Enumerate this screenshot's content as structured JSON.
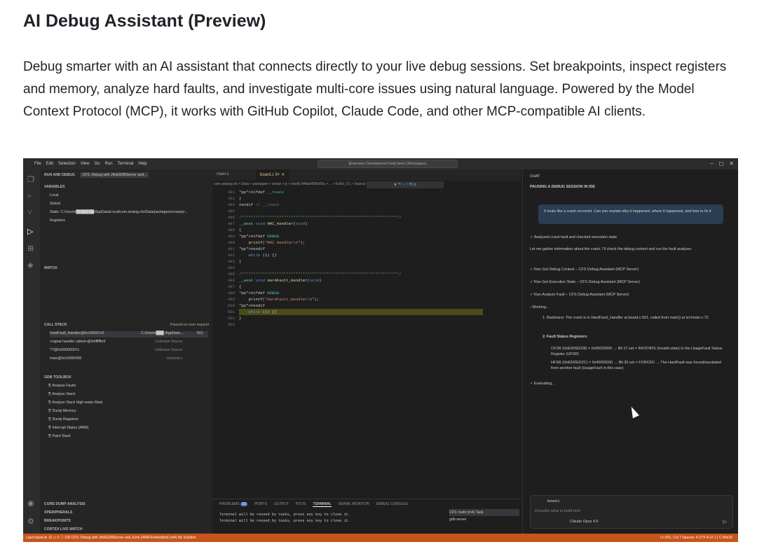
{
  "article": {
    "title": "AI Debug Assistant (Preview)",
    "body": "Debug smarter with an AI assistant that connects directly to your live debug sessions. Set breakpoints, inspect registers and memory, analyze hard faults, and investigate multi-core issues using natural language. Powered by the Model Context Protocol (MCP), it works with GitHub Copilot, Claude Code, and other MCP-compatible AI clients."
  },
  "window": {
    "menu": [
      "File",
      "Edit",
      "Selection",
      "View",
      "Go",
      "Run",
      "Terminal",
      "Help"
    ],
    "search": "[Extension Development Host] demo (Workspace)"
  },
  "sidebar": {
    "run_debug": "RUN AND DEBUG",
    "config": "CFS: Debug with JlinkGDBServer and...",
    "variables": "VARIABLES",
    "local": "Local",
    "global": "Global",
    "static": "Static: C:/Users/███████/AppData/Local/com.analog.cfs/Data/packages/conan/p/...",
    "registers": "Registers",
    "watch": "WATCH",
    "call_stack": "CALL STACK",
    "paused": "Paused on user request",
    "frames": [
      {
        "name": "HardFault_Handler@0x100007c0",
        "file": "C:/Users/███ /AppData...",
        "line": "501"
      },
      {
        "name": "<signal handler called>@0xfffffffe9",
        "file": "Unknown Source",
        "line": ""
      },
      {
        "name": "??@0x00000007c",
        "file": "Unknown Source",
        "line": ""
      },
      {
        "name": "main@0x10000458",
        "file": "src/main.c",
        "line": ""
      }
    ],
    "gdb_toolbox": "GDB TOOLBOX",
    "tools": [
      "Analyze Faults",
      "Analyze Stack",
      "Analyze Stack High-water Mark",
      "Dump Memory",
      "Dump Registers",
      "Interrupt Status (ARM)",
      "Paint Stack"
    ],
    "bottom_sections": [
      "CORE DUMP ANALYSIS",
      "XPERIPHERALS",
      "BREAKPOINTS",
      "CORTEX LIVE WATCH"
    ]
  },
  "editor": {
    "tabs": [
      "main.c",
      "board.c 9+"
    ],
    "breadcrumb": "com.analog.cfs > Data > packages > conan > p > msdk7d4ba5426e00a > ... > EvKit_V1 > Source > board.c",
    "lines": [
      {
        "n": "481",
        "t": "#ifdef __riscv"
      },
      {
        "n": "483",
        "t": "}"
      },
      {
        "n": "484",
        "t": "#endif // __riscv"
      },
      {
        "n": "485",
        "t": ""
      },
      {
        "n": "486",
        "t": "/*******************************************************************/"
      },
      {
        "n": "487",
        "t": "__weak void NMI_Handler(void)"
      },
      {
        "n": "488",
        "t": "{"
      },
      {
        "n": "489",
        "t": "#ifdef DEBUG"
      },
      {
        "n": "490",
        "t": "    printf(\"NMI Handler\\n\");"
      },
      {
        "n": "491",
        "t": "#endif"
      },
      {
        "n": "492",
        "t": "    while (1) {}"
      },
      {
        "n": "493",
        "t": "}"
      },
      {
        "n": "494",
        "t": ""
      },
      {
        "n": "495",
        "t": "/*******************************************************************/"
      },
      {
        "n": "496",
        "t": "__weak void HardFault_Handler(void)"
      },
      {
        "n": "497",
        "t": "{"
      },
      {
        "n": "498",
        "t": "#ifdef DEBUG"
      },
      {
        "n": "499",
        "t": "    printf(\"HardFault_Handler\\n\");"
      },
      {
        "n": "500",
        "t": "#endif"
      },
      {
        "n": "501",
        "t": "    while (1) {}"
      },
      {
        "n": "502",
        "t": "}"
      },
      {
        "n": "503",
        "t": ""
      }
    ]
  },
  "panel": {
    "tabs": [
      "PROBLEMS",
      "PORTS",
      "OUTPUT",
      "RTOS",
      "TERMINAL",
      "SERIAL MONITOR",
      "DEBUG CONSOLE"
    ],
    "problems_count": "10",
    "terminal": [
      "Terminal will be reused by tasks, press any key to close it.",
      "Terminal will be reused by tasks, press any key to close it."
    ],
    "tasks": [
      "CFS: build (m4) Task",
      "gdb-server"
    ]
  },
  "chat": {
    "header": "CHAT",
    "session": "PAUSING A DEBUG SESSION IN IDE",
    "user_msg": "It looks like a crash occurred. Can you explain why it happened, where it happened, and how to fix it",
    "analyzed": "Analyzed crash fault and checked execution state",
    "intro": "Let me gather information about the crash. I'll check the debug context and run the fault analyzer.",
    "tools": [
      "Ran Get Debug Context – CFS Debug Assistant (MCP Server)",
      "Ran Get Execution State – CFS Debug Assistant (MCP Server)",
      "Ran Analyze Fault – CFS Debug Assistant (MCP Server)"
    ],
    "working": "Working...",
    "backtrace": "1. Backtrace: The crash is in HardFault_Handler at board.c:501, called from main() at src/main.c:72.",
    "fault_regs": "2. Fault Status Registers:",
    "cfsr": "CFSR (0xE000ED28) = 0x00020000 → Bit 17 set = INVSTATE (Invalid state) in the UsageFault Status Register (UFSR)",
    "hfsr": "HFSR (0xE000ED2C) = 0x40000000 → Bit 30 set = FORCED → The HardFault was forced/escalated from another fault (UsageFault in this case)",
    "evaluating": "Evaluating...",
    "file_chip": "board.c",
    "placeholder": "Describe what to build next",
    "model": "Claude Opus 4.6"
  },
  "status": {
    "left": "Launchpad   ⊗ 12 ⚠ 0 ⓘ 100   CFS: Debug with JlinkGDBServer and JLink (ARM Embedded) (m4)   No Solution",
    "right": "Ln 501, Col 7   Spaces: 4   UTF-8   LF   { } C   Win32"
  }
}
